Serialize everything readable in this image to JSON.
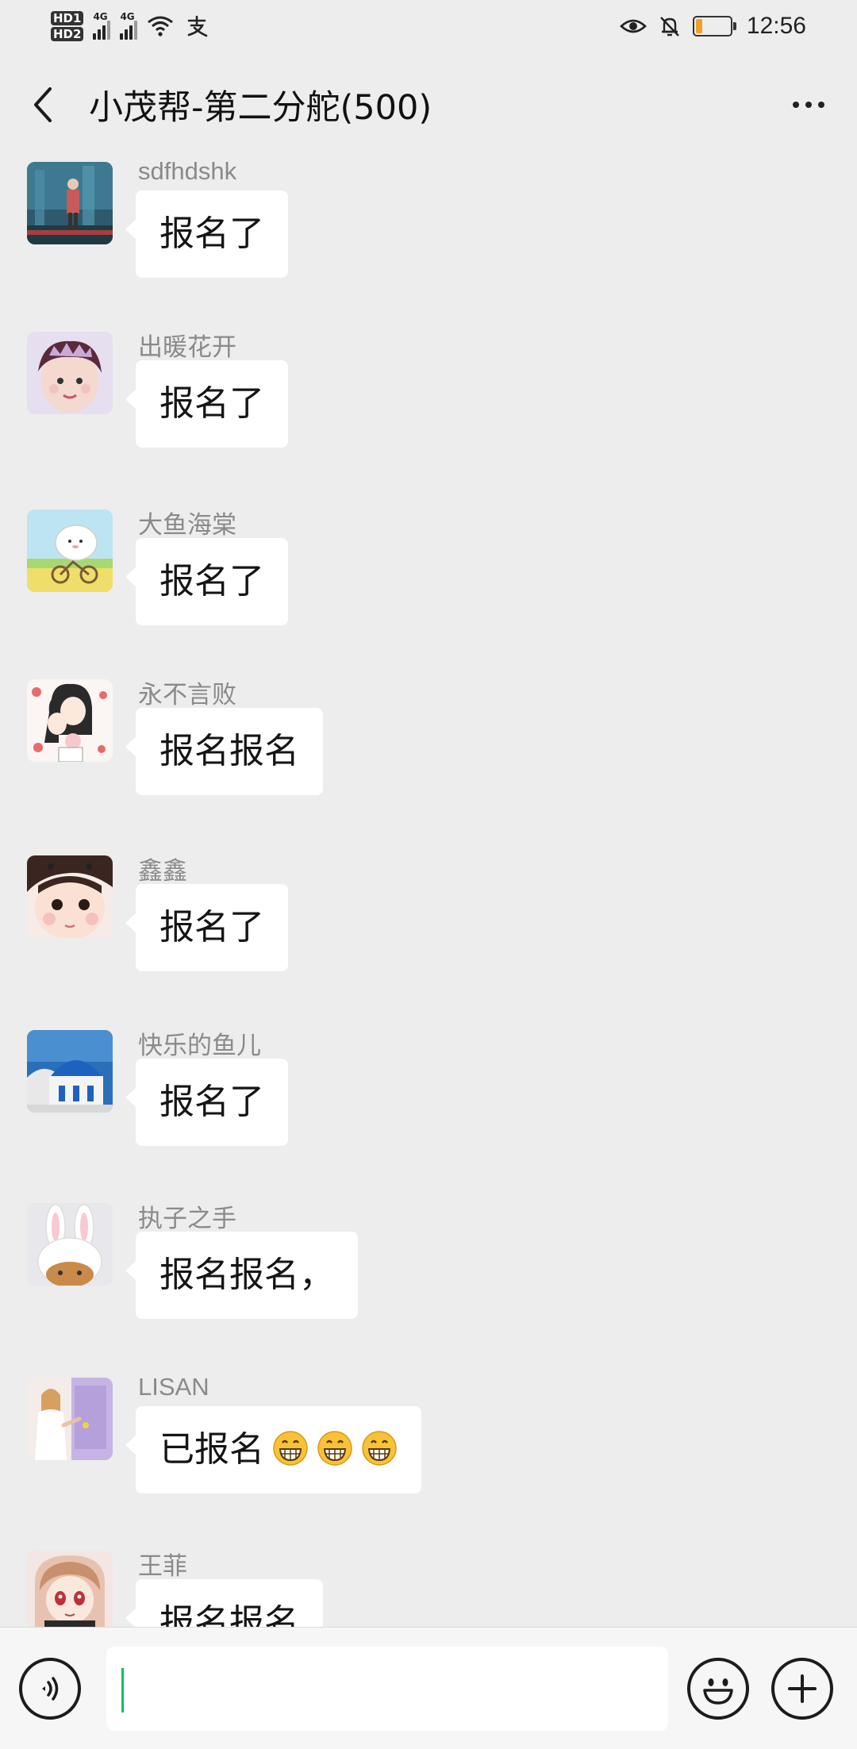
{
  "status_bar": {
    "hd1": "HD1",
    "hd2": "HD2",
    "signal_label_1": "4G",
    "signal_label_2": "4G",
    "payment_icon": "alipay-icon",
    "battery_level": 0.2,
    "battery_color": "#f0a028",
    "time": "12:56"
  },
  "header": {
    "title": "小茂帮-第二分舵(500)"
  },
  "messages": [
    {
      "sender": "sdfhdshk",
      "text": "报名了",
      "avatar": "street-photo"
    },
    {
      "sender": "出暖花开",
      "text": "报名了",
      "avatar": "girl-with-tiara"
    },
    {
      "sender": "大鱼海棠",
      "text": "报名了",
      "avatar": "cartoon-bike"
    },
    {
      "sender": "永不言败",
      "text": "报名报名",
      "avatar": "cartoon-family"
    },
    {
      "sender": "鑫鑫",
      "text": "报名了",
      "avatar": "child-face"
    },
    {
      "sender": "快乐的鱼儿",
      "text": "报名了",
      "avatar": "blue-dome"
    },
    {
      "sender": "执子之手",
      "text": "报名报名，",
      "avatar": "cat-bunny-hat"
    },
    {
      "sender": "LISAN",
      "text": "已报名",
      "emoji_count": 3,
      "avatar": "painting-girl"
    },
    {
      "sender": "王菲",
      "text": "报名报名",
      "avatar": "anime-girl"
    }
  ],
  "input_bar": {
    "text_value": "",
    "voice_icon": "voice-icon",
    "emoji_icon": "emoji-icon",
    "plus_icon": "plus-icon"
  },
  "colors": {
    "background": "#ededed",
    "bubble": "#ffffff",
    "accent_caret": "#07c160"
  }
}
